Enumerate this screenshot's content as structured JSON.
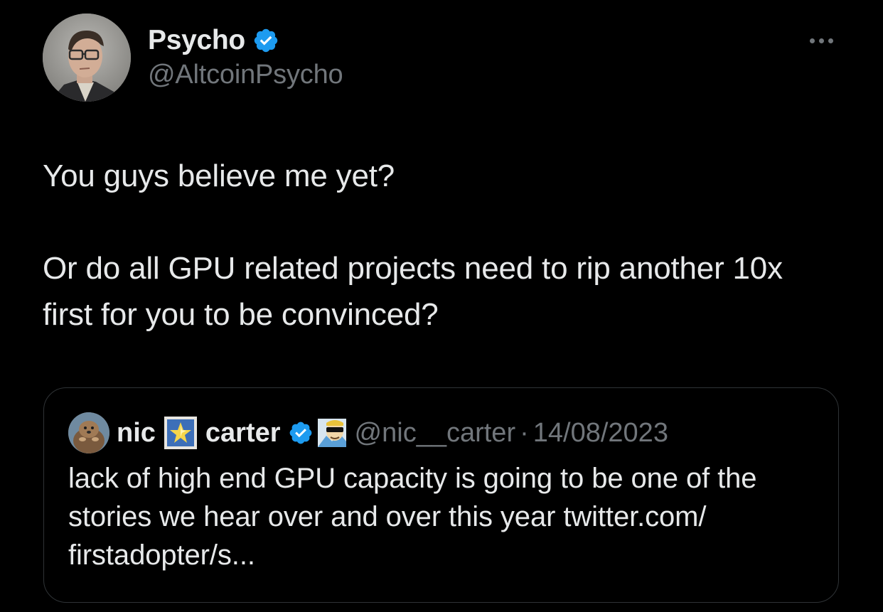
{
  "author": {
    "name": "Psycho",
    "handle": "@AltcoinPsycho",
    "verified": true,
    "verified_color": "#1d9bf0"
  },
  "more_icon": "more-horizontal-icon",
  "tweet": {
    "paragraphs": [
      "You guys believe me yet?",
      "Or do all GPU related projects need to rip another 10x first for you to be convinced?"
    ]
  },
  "quote": {
    "name_first": "nic",
    "name_emoji": "framed-star-icon",
    "name_last": "carter",
    "verified": true,
    "affiliate_badge": "sunglasses-nft-badge-icon",
    "handle": "@nic__carter",
    "separator": "·",
    "date": "14/08/2023",
    "text": "lack of high end GPU capacity is going to be one of the stories we hear over and over this year twitter.com/ firstadopter/s..."
  },
  "colors": {
    "background": "#000000",
    "primary_text": "#e7e9ea",
    "secondary_text": "#71767b",
    "border": "#2f3336",
    "accent": "#1d9bf0"
  }
}
